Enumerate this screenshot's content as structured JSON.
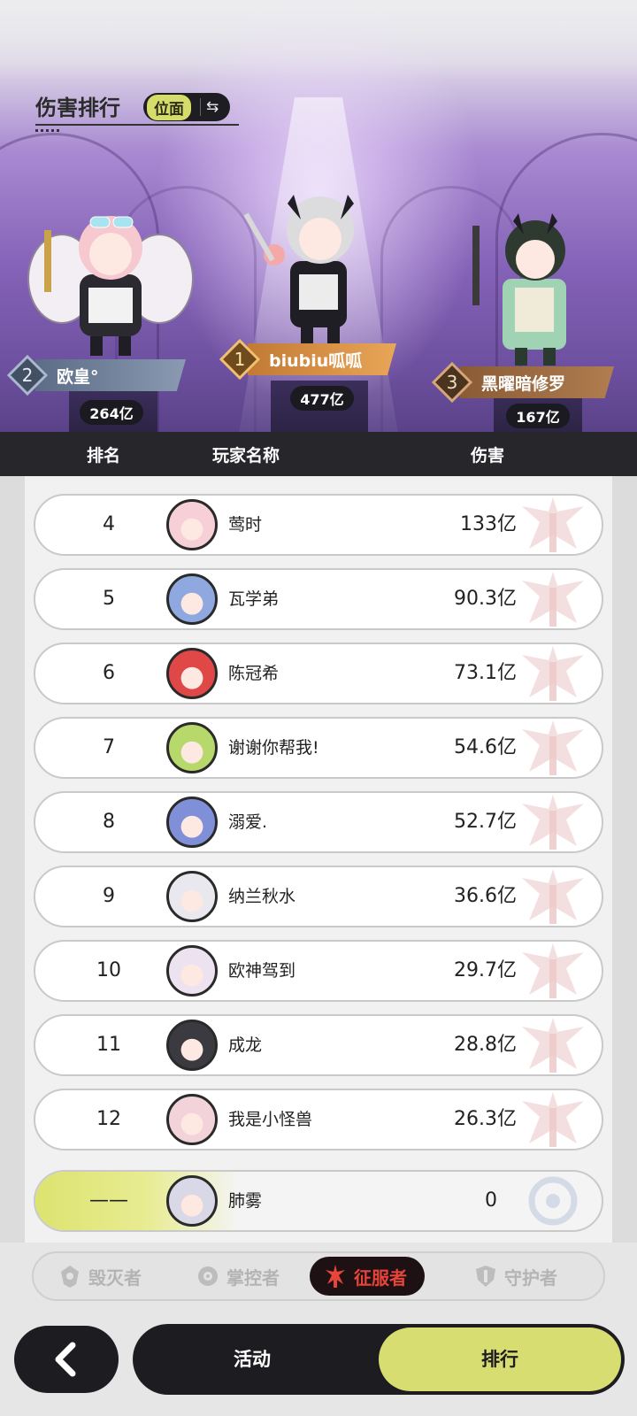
{
  "header": {
    "title": "伤害排行",
    "toggle_label": "位面",
    "toggle_icon": "swap-arrows-icon"
  },
  "podium": [
    {
      "rank": "1",
      "name": "biubiu呱呱",
      "damage": "477亿"
    },
    {
      "rank": "2",
      "name": "欧皇°",
      "damage": "264亿"
    },
    {
      "rank": "3",
      "name": "黑曜暗修罗",
      "damage": "167亿"
    }
  ],
  "table": {
    "columns": [
      "排名",
      "玩家名称",
      "伤害"
    ],
    "rows": [
      {
        "rank": "4",
        "name": "莺时",
        "damage": "133亿"
      },
      {
        "rank": "5",
        "name": "瓦学弟",
        "damage": "90.3亿"
      },
      {
        "rank": "6",
        "name": "陈冠希",
        "damage": "73.1亿"
      },
      {
        "rank": "7",
        "name": "谢谢你帮我!",
        "damage": "54.6亿"
      },
      {
        "rank": "8",
        "name": "溺爱.",
        "damage": "52.7亿"
      },
      {
        "rank": "9",
        "name": "纳兰秋水",
        "damage": "36.6亿"
      },
      {
        "rank": "10",
        "name": "欧神驾到",
        "damage": "29.7亿"
      },
      {
        "rank": "11",
        "name": "成龙",
        "damage": "28.8亿"
      },
      {
        "rank": "12",
        "name": "我是小怪兽",
        "damage": "26.3亿"
      }
    ],
    "self_row": {
      "rank": "——",
      "name": "肺雾",
      "damage": "0"
    }
  },
  "class_tabs": [
    {
      "label": "毁灭者",
      "icon": "destroyer-emblem-icon",
      "active": false
    },
    {
      "label": "掌控者",
      "icon": "controller-emblem-icon",
      "active": false
    },
    {
      "label": "征服者",
      "icon": "conqueror-emblem-icon",
      "active": true
    },
    {
      "label": "守护者",
      "icon": "guardian-emblem-icon",
      "active": false
    }
  ],
  "bottom_nav": {
    "back_icon": "back-chevron-icon",
    "activity_label": "活动",
    "ranking_label": "排行"
  },
  "colors": {
    "accent_lime": "#d8dd71",
    "dark": "#1d1c21",
    "conqueror_red": "#e8453a",
    "gold_plate": "#d9954a",
    "silver_plate": "#7f8fa6",
    "bronze_plate": "#a5744a"
  }
}
